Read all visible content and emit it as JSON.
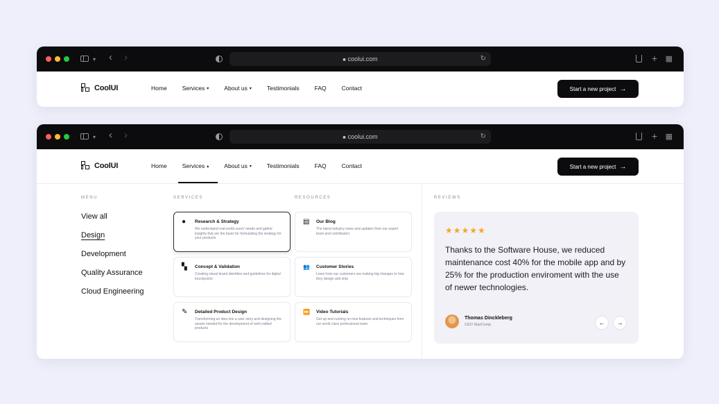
{
  "browser": {
    "url": "coolui.com"
  },
  "nav": {
    "logo": "CoolUI",
    "links": [
      "Home",
      "Services",
      "About us",
      "Testimonials",
      "FAQ",
      "Contact"
    ],
    "cta": "Start a new project",
    "cta_arrow": "→"
  },
  "mega": {
    "menu_label": "MENU",
    "menu_items": [
      "View all",
      "Design",
      "Development",
      "Quality Assurance",
      "Cloud Engineering"
    ],
    "services_label": "SERVICES",
    "services": [
      {
        "icon": "●",
        "icon_name": "circle-icon",
        "title": "Research & Strategy",
        "desc": "We understand real-world users' needs and gather insights that are the basis for formulating the strategy for your products"
      },
      {
        "icon": "▚",
        "icon_name": "grid-icon",
        "title": "Concept & Validation",
        "desc": "Creating visual brand identities and guidelines for digital touchpoints"
      },
      {
        "icon": "✎",
        "icon_name": "pen-icon",
        "title": "Detailed Product Design",
        "desc": "Transforming an idea into a user story and designing the assets needed for the development of well-crafted products"
      }
    ],
    "resources_label": "RESOURCES",
    "resources": [
      {
        "icon": "▤",
        "icon_name": "book-icon",
        "title": "Our Blog",
        "desc": "The latest industry news and updates from our expert team and contributors"
      },
      {
        "icon": "👥",
        "icon_name": "users-icon",
        "title": "Customer Stories",
        "desc": "Learn how our customers are making big changes to how they design and ship"
      },
      {
        "icon": "⏩",
        "icon_name": "video-icon",
        "title": "Video Tutorials",
        "desc": "Get up and running on new features and techniques from our world class professional team"
      }
    ],
    "reviews_label": "REVIEWS",
    "review": {
      "stars": "★★★★★",
      "quote": "Thanks to the Software House, we reduced maintenance cost 40% for the mobile app and by 25% for the production enviroment with the use of newer technologies.",
      "author": "Thomas Dinckleberg",
      "role": "CEO StarComp",
      "prev": "←",
      "next": "→"
    }
  },
  "colors": {
    "background": "#eeeffa",
    "titlebar": "#0c0c0e",
    "star": "#f5a623"
  }
}
